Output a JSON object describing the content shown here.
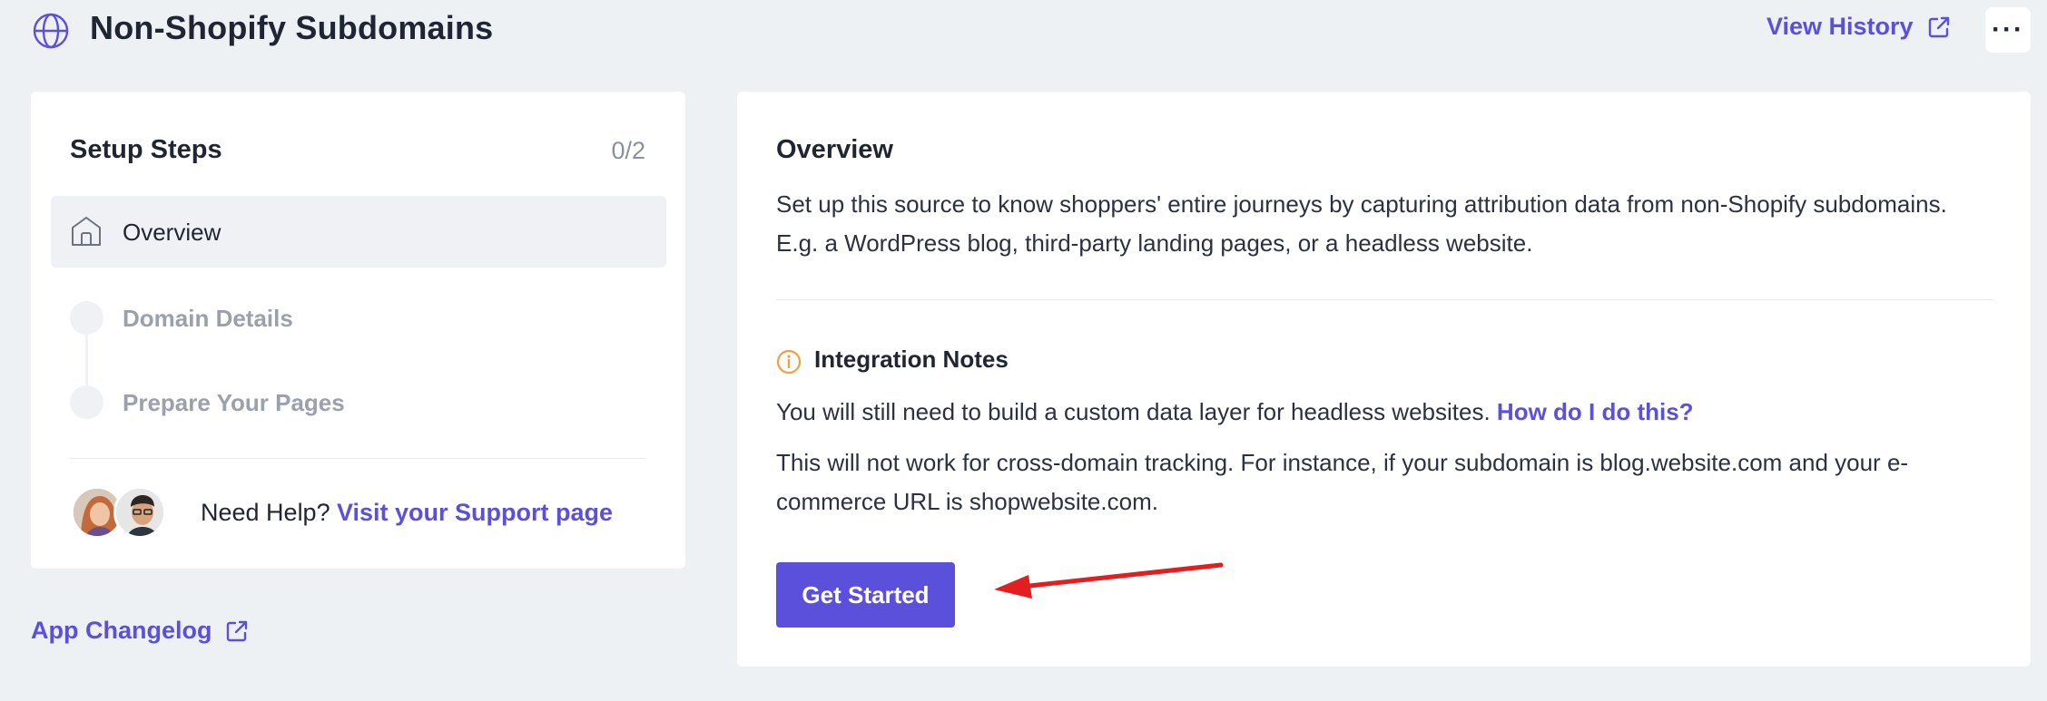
{
  "header": {
    "title": "Non-Shopify Subdomains",
    "view_history": "View History",
    "more_label": "···",
    "icons": {
      "globe": "globe-icon",
      "external": "external-link-icon"
    }
  },
  "setup": {
    "title": "Setup Steps",
    "count": "0/2",
    "steps": [
      {
        "label": "Overview",
        "active": true,
        "icon": "home-icon"
      },
      {
        "label": "Domain Details",
        "active": false
      },
      {
        "label": "Prepare Your Pages",
        "active": false
      }
    ],
    "help_text": "Need Help?",
    "support_link": "Visit your Support page"
  },
  "changelog": {
    "label": "App Changelog"
  },
  "overview": {
    "title": "Overview",
    "description": "Set up this source to know shoppers' entire journeys by capturing attribution data from non-Shopify subdomains. E.g. a WordPress blog, third-party landing pages, or a headless website.",
    "notes_title": "Integration Notes",
    "note1_text": "You will still need to build a custom data layer for headless websites. ",
    "note1_link": "How do I do this?",
    "note2_text": "This will not work for cross-domain tracking. For instance, if your subdomain is blog.website.com and your e-commerce URL is shopwebsite.com.",
    "button": "Get Started"
  },
  "colors": {
    "accent": "#5b50dc",
    "background": "#eef1f4",
    "warning": "#f0a040",
    "arrow": "#e41e1e"
  }
}
